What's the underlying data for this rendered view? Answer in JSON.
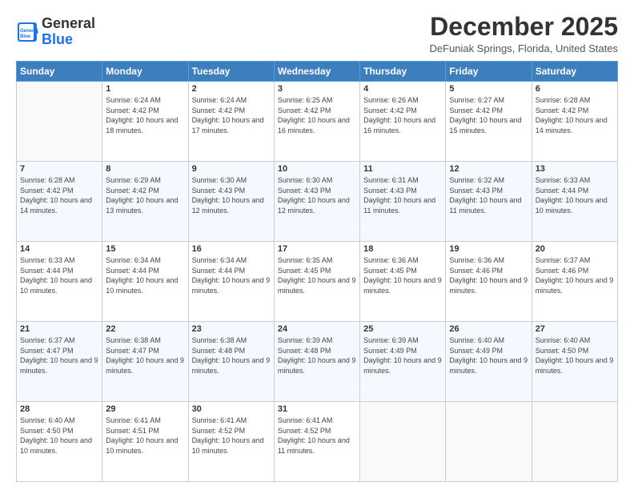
{
  "logo": {
    "text_general": "General",
    "text_blue": "Blue"
  },
  "title": "December 2025",
  "location": "DeFuniak Springs, Florida, United States",
  "weekdays": [
    "Sunday",
    "Monday",
    "Tuesday",
    "Wednesday",
    "Thursday",
    "Friday",
    "Saturday"
  ],
  "weeks": [
    [
      {
        "day": "",
        "info": ""
      },
      {
        "day": "1",
        "info": "Sunrise: 6:24 AM\nSunset: 4:42 PM\nDaylight: 10 hours\nand 18 minutes."
      },
      {
        "day": "2",
        "info": "Sunrise: 6:24 AM\nSunset: 4:42 PM\nDaylight: 10 hours\nand 17 minutes."
      },
      {
        "day": "3",
        "info": "Sunrise: 6:25 AM\nSunset: 4:42 PM\nDaylight: 10 hours\nand 16 minutes."
      },
      {
        "day": "4",
        "info": "Sunrise: 6:26 AM\nSunset: 4:42 PM\nDaylight: 10 hours\nand 16 minutes."
      },
      {
        "day": "5",
        "info": "Sunrise: 6:27 AM\nSunset: 4:42 PM\nDaylight: 10 hours\nand 15 minutes."
      },
      {
        "day": "6",
        "info": "Sunrise: 6:28 AM\nSunset: 4:42 PM\nDaylight: 10 hours\nand 14 minutes."
      }
    ],
    [
      {
        "day": "7",
        "info": "Sunrise: 6:28 AM\nSunset: 4:42 PM\nDaylight: 10 hours\nand 14 minutes."
      },
      {
        "day": "8",
        "info": "Sunrise: 6:29 AM\nSunset: 4:42 PM\nDaylight: 10 hours\nand 13 minutes."
      },
      {
        "day": "9",
        "info": "Sunrise: 6:30 AM\nSunset: 4:43 PM\nDaylight: 10 hours\nand 12 minutes."
      },
      {
        "day": "10",
        "info": "Sunrise: 6:30 AM\nSunset: 4:43 PM\nDaylight: 10 hours\nand 12 minutes."
      },
      {
        "day": "11",
        "info": "Sunrise: 6:31 AM\nSunset: 4:43 PM\nDaylight: 10 hours\nand 11 minutes."
      },
      {
        "day": "12",
        "info": "Sunrise: 6:32 AM\nSunset: 4:43 PM\nDaylight: 10 hours\nand 11 minutes."
      },
      {
        "day": "13",
        "info": "Sunrise: 6:33 AM\nSunset: 4:44 PM\nDaylight: 10 hours\nand 10 minutes."
      }
    ],
    [
      {
        "day": "14",
        "info": "Sunrise: 6:33 AM\nSunset: 4:44 PM\nDaylight: 10 hours\nand 10 minutes."
      },
      {
        "day": "15",
        "info": "Sunrise: 6:34 AM\nSunset: 4:44 PM\nDaylight: 10 hours\nand 10 minutes."
      },
      {
        "day": "16",
        "info": "Sunrise: 6:34 AM\nSunset: 4:44 PM\nDaylight: 10 hours\nand 9 minutes."
      },
      {
        "day": "17",
        "info": "Sunrise: 6:35 AM\nSunset: 4:45 PM\nDaylight: 10 hours\nand 9 minutes."
      },
      {
        "day": "18",
        "info": "Sunrise: 6:36 AM\nSunset: 4:45 PM\nDaylight: 10 hours\nand 9 minutes."
      },
      {
        "day": "19",
        "info": "Sunrise: 6:36 AM\nSunset: 4:46 PM\nDaylight: 10 hours\nand 9 minutes."
      },
      {
        "day": "20",
        "info": "Sunrise: 6:37 AM\nSunset: 4:46 PM\nDaylight: 10 hours\nand 9 minutes."
      }
    ],
    [
      {
        "day": "21",
        "info": "Sunrise: 6:37 AM\nSunset: 4:47 PM\nDaylight: 10 hours\nand 9 minutes."
      },
      {
        "day": "22",
        "info": "Sunrise: 6:38 AM\nSunset: 4:47 PM\nDaylight: 10 hours\nand 9 minutes."
      },
      {
        "day": "23",
        "info": "Sunrise: 6:38 AM\nSunset: 4:48 PM\nDaylight: 10 hours\nand 9 minutes."
      },
      {
        "day": "24",
        "info": "Sunrise: 6:39 AM\nSunset: 4:48 PM\nDaylight: 10 hours\nand 9 minutes."
      },
      {
        "day": "25",
        "info": "Sunrise: 6:39 AM\nSunset: 4:49 PM\nDaylight: 10 hours\nand 9 minutes."
      },
      {
        "day": "26",
        "info": "Sunrise: 6:40 AM\nSunset: 4:49 PM\nDaylight: 10 hours\nand 9 minutes."
      },
      {
        "day": "27",
        "info": "Sunrise: 6:40 AM\nSunset: 4:50 PM\nDaylight: 10 hours\nand 9 minutes."
      }
    ],
    [
      {
        "day": "28",
        "info": "Sunrise: 6:40 AM\nSunset: 4:50 PM\nDaylight: 10 hours\nand 10 minutes."
      },
      {
        "day": "29",
        "info": "Sunrise: 6:41 AM\nSunset: 4:51 PM\nDaylight: 10 hours\nand 10 minutes."
      },
      {
        "day": "30",
        "info": "Sunrise: 6:41 AM\nSunset: 4:52 PM\nDaylight: 10 hours\nand 10 minutes."
      },
      {
        "day": "31",
        "info": "Sunrise: 6:41 AM\nSunset: 4:52 PM\nDaylight: 10 hours\nand 11 minutes."
      },
      {
        "day": "",
        "info": ""
      },
      {
        "day": "",
        "info": ""
      },
      {
        "day": "",
        "info": ""
      }
    ]
  ]
}
